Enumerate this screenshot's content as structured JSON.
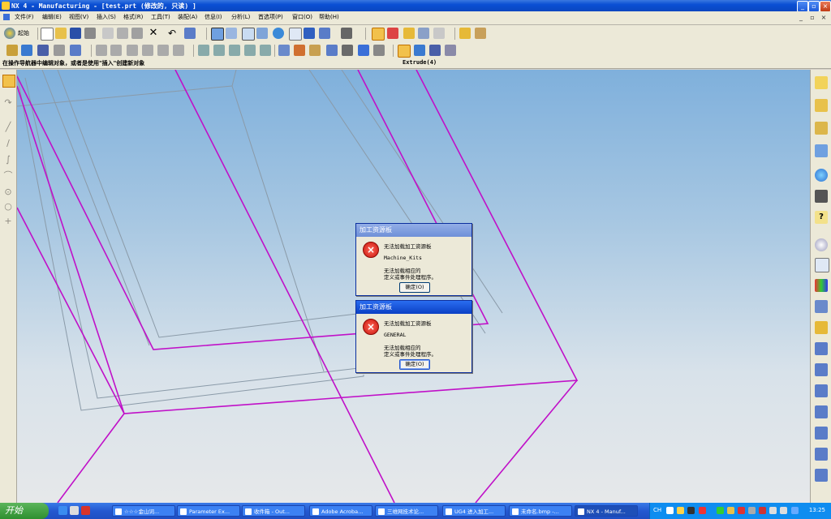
{
  "window": {
    "title": "NX 4 - Manufacturing - [test.prt  (修改的, 只读) ]",
    "min_label": "_",
    "max_label": "▫",
    "close_label": "×"
  },
  "menu": {
    "items": [
      "文件(F)",
      "编辑(E)",
      "视图(V)",
      "插入(S)",
      "格式(R)",
      "工具(T)",
      "装配(A)",
      "信息(I)",
      "分析(L)",
      "首选项(P)",
      "窗口(O)",
      "帮助(H)"
    ],
    "start_label": "起始",
    "win_min": "_",
    "win_restore": "▫",
    "win_close": "×"
  },
  "status": {
    "message": "在操作导航器中编辑对象，或者是使用\"插入\"创建新对象",
    "feature": "Extrude(4)"
  },
  "dialogs": [
    {
      "title": "加工资源板",
      "line1": "无法加载加工资源板",
      "item": "Machine_Kits",
      "line2": "无法加载相应的",
      "line3": "定义或事件处理程序。",
      "ok": "确定(O)"
    },
    {
      "title": "加工资源板",
      "line1": "无法加载加工资源板",
      "item": "GENERAL",
      "line2": "无法加载相应的",
      "line3": "定义或事件处理程序。",
      "ok": "确定(O)"
    }
  ],
  "taskbar": {
    "start": "开始",
    "tasks": [
      "☆☆☆金山词...",
      "Parameter Ex...",
      "收件箱 - Out...",
      "Adobe Acroba...",
      "三维网技术论...",
      "UG4 进入加工...",
      "未命名.bmp -...",
      "NX 4 - Manuf..."
    ],
    "lang": "CH",
    "clock": "13:25"
  },
  "colors": {
    "edge_magenta": "#c010c8",
    "edge_gray": "#8a9aa8"
  }
}
